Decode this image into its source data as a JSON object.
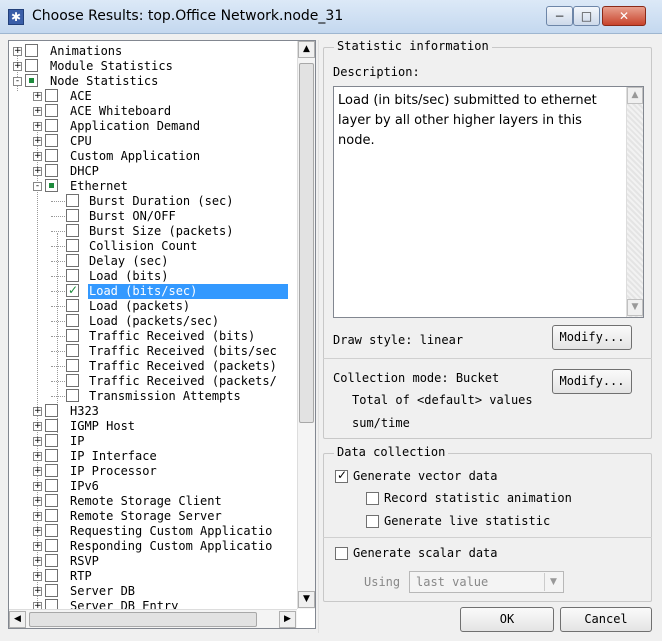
{
  "window": {
    "title": "Choose Results: top.Office Network.node_31",
    "app_icon": "opnet-star-icon",
    "min_glyph": "−",
    "max_glyph": "□",
    "close_glyph": "✕"
  },
  "tree": {
    "items": [
      {
        "label": "Animations",
        "level": 0,
        "expander": "+",
        "state": "none"
      },
      {
        "label": "Module Statistics",
        "level": 0,
        "expander": "+",
        "state": "none"
      },
      {
        "label": "Node Statistics",
        "level": 0,
        "expander": "-",
        "state": "partial"
      },
      {
        "label": "ACE",
        "level": 1,
        "expander": "+",
        "state": "none"
      },
      {
        "label": "ACE Whiteboard",
        "level": 1,
        "expander": "+",
        "state": "none"
      },
      {
        "label": "Application Demand",
        "level": 1,
        "expander": "+",
        "state": "none"
      },
      {
        "label": "CPU",
        "level": 1,
        "expander": "+",
        "state": "none"
      },
      {
        "label": "Custom Application",
        "level": 1,
        "expander": "+",
        "state": "none"
      },
      {
        "label": "DHCP",
        "level": 1,
        "expander": "+",
        "state": "none"
      },
      {
        "label": "Ethernet",
        "level": 1,
        "expander": "-",
        "state": "partial"
      },
      {
        "label": "Burst Duration (sec)",
        "level": 2,
        "expander": "",
        "state": "none"
      },
      {
        "label": "Burst ON/OFF",
        "level": 2,
        "expander": "",
        "state": "none"
      },
      {
        "label": "Burst Size (packets)",
        "level": 2,
        "expander": "",
        "state": "none"
      },
      {
        "label": "Collision Count",
        "level": 2,
        "expander": "",
        "state": "none"
      },
      {
        "label": "Delay (sec)",
        "level": 2,
        "expander": "",
        "state": "none"
      },
      {
        "label": "Load (bits)",
        "level": 2,
        "expander": "",
        "state": "none"
      },
      {
        "label": "Load (bits/sec)",
        "level": 2,
        "expander": "",
        "state": "checked",
        "selected": true
      },
      {
        "label": "Load (packets)",
        "level": 2,
        "expander": "",
        "state": "none"
      },
      {
        "label": "Load (packets/sec)",
        "level": 2,
        "expander": "",
        "state": "none"
      },
      {
        "label": "Traffic Received (bits)",
        "level": 2,
        "expander": "",
        "state": "none"
      },
      {
        "label": "Traffic Received (bits/sec",
        "level": 2,
        "expander": "",
        "state": "none"
      },
      {
        "label": "Traffic Received (packets)",
        "level": 2,
        "expander": "",
        "state": "none"
      },
      {
        "label": "Traffic Received (packets/",
        "level": 2,
        "expander": "",
        "state": "none"
      },
      {
        "label": "Transmission Attempts",
        "level": 2,
        "expander": "",
        "state": "none"
      },
      {
        "label": "H323",
        "level": 1,
        "expander": "+",
        "state": "none"
      },
      {
        "label": "IGMP Host",
        "level": 1,
        "expander": "+",
        "state": "none"
      },
      {
        "label": "IP",
        "level": 1,
        "expander": "+",
        "state": "none"
      },
      {
        "label": "IP Interface",
        "level": 1,
        "expander": "+",
        "state": "none"
      },
      {
        "label": "IP Processor",
        "level": 1,
        "expander": "+",
        "state": "none"
      },
      {
        "label": "IPv6",
        "level": 1,
        "expander": "+",
        "state": "none"
      },
      {
        "label": "Remote Storage Client",
        "level": 1,
        "expander": "+",
        "state": "none"
      },
      {
        "label": "Remote Storage Server",
        "level": 1,
        "expander": "+",
        "state": "none"
      },
      {
        "label": "Requesting Custom Applicatio",
        "level": 1,
        "expander": "+",
        "state": "none"
      },
      {
        "label": "Responding Custom Applicatio",
        "level": 1,
        "expander": "+",
        "state": "none"
      },
      {
        "label": "RSVP",
        "level": 1,
        "expander": "+",
        "state": "none"
      },
      {
        "label": "RTP",
        "level": 1,
        "expander": "+",
        "state": "none"
      },
      {
        "label": "Server DB",
        "level": 1,
        "expander": "+",
        "state": "none"
      },
      {
        "label": "Server DB Entry",
        "level": 1,
        "expander": "+",
        "state": "none"
      }
    ]
  },
  "stat_info": {
    "group_title": "Statistic information",
    "description_label": "Description:",
    "description_text": "Load (in bits/sec) submitted to ethernet layer by all other higher layers in this node.",
    "draw_style": "Draw style: linear",
    "modify_label": "Modify...",
    "collection_mode": "Collection mode: Bucket",
    "collection_line1": "Total of <default> values",
    "collection_line2": "sum/time",
    "modify2_label": "Modify..."
  },
  "data_collection": {
    "group_title": "Data collection",
    "generate_vector": "Generate vector data",
    "generate_vector_checked": true,
    "record_animation": "Record statistic animation",
    "generate_live": "Generate live statistic",
    "generate_scalar": "Generate scalar data",
    "using_label": "Using",
    "using_value": "last value"
  },
  "buttons": {
    "ok": "OK",
    "cancel": "Cancel"
  },
  "colors": {
    "selection": "#3399ff",
    "check_green": "#1d8a3c"
  }
}
